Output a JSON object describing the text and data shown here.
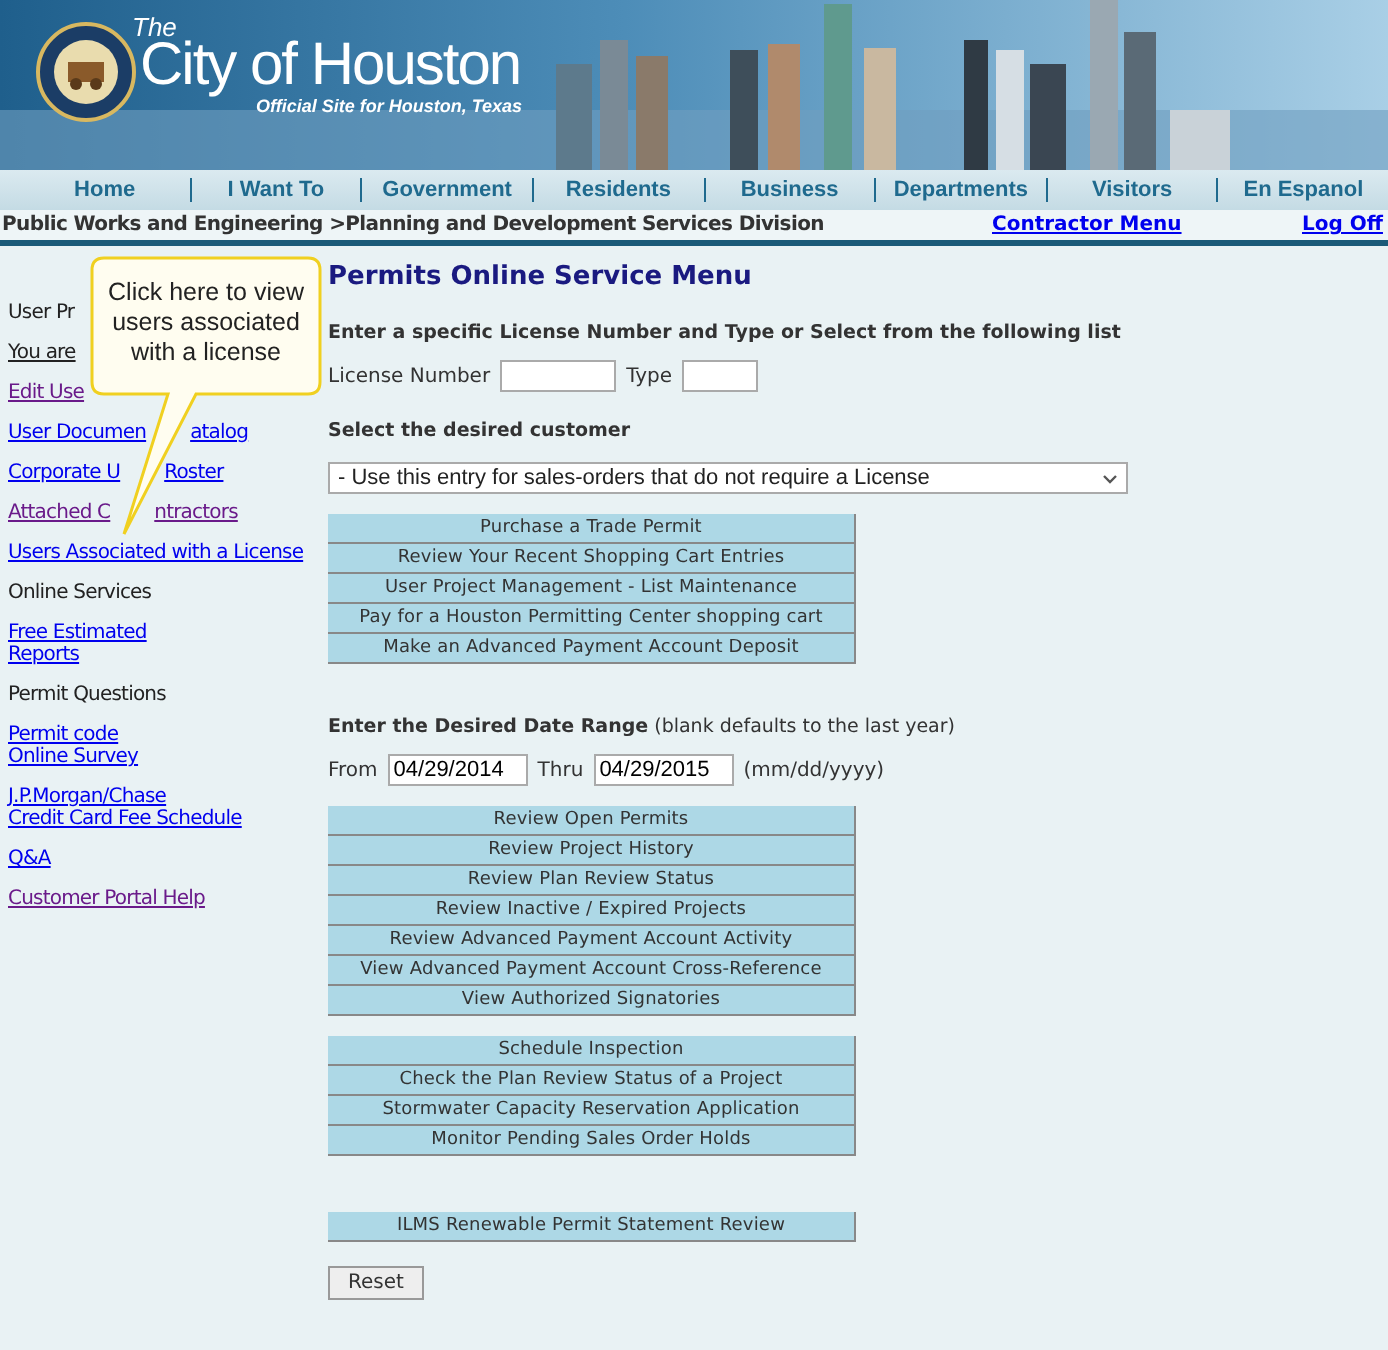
{
  "header": {
    "pretitle": "The",
    "title": "City of Houston",
    "subtitle": "Official Site for Houston, Texas"
  },
  "nav": [
    "Home",
    "I Want To",
    "Government",
    "Residents",
    "Business",
    "Departments",
    "Visitors",
    "En Espanol"
  ],
  "breadcrumb": {
    "path": "Public Works and Engineering >Planning and Development Services Division",
    "links": [
      "Contractor Menu",
      "Log Off"
    ]
  },
  "sidebar": [
    {
      "kind": "heading",
      "lines": [
        {
          "text": "User Pr"
        }
      ]
    },
    {
      "kind": "current",
      "lines": [
        {
          "text": "You are"
        }
      ]
    },
    {
      "kind": "link",
      "visited": true,
      "lines": [
        {
          "text": "Edit Use"
        }
      ]
    },
    {
      "kind": "link",
      "visited": false,
      "lines": [
        {
          "text": "User Documen",
          "after": "atalog"
        }
      ]
    },
    {
      "kind": "link",
      "visited": false,
      "lines": [
        {
          "text": "Corporate U",
          "after": "Roster"
        }
      ]
    },
    {
      "kind": "link",
      "visited": true,
      "lines": [
        {
          "text": "Attached C",
          "after": "ntractors"
        }
      ]
    },
    {
      "kind": "link",
      "visited": false,
      "lines": [
        {
          "text": "Users Associated with a License"
        }
      ]
    },
    {
      "kind": "heading",
      "lines": [
        {
          "text": "Online Services"
        }
      ]
    },
    {
      "kind": "link",
      "visited": false,
      "lines": [
        {
          "text": "Free Estimated"
        },
        {
          "text": "Reports"
        }
      ]
    },
    {
      "kind": "heading",
      "lines": [
        {
          "text": "Permit Questions"
        }
      ]
    },
    {
      "kind": "link",
      "visited": false,
      "lines": [
        {
          "text": "Permit code"
        },
        {
          "text": "Online Survey"
        }
      ]
    },
    {
      "kind": "link",
      "visited": false,
      "lines": [
        {
          "text": "J.P.Morgan/Chase"
        },
        {
          "text": "Credit Card Fee Schedule"
        }
      ]
    },
    {
      "kind": "link",
      "visited": false,
      "lines": [
        {
          "text": "Q&A"
        }
      ]
    },
    {
      "kind": "link",
      "visited": true,
      "lines": [
        {
          "text": "Customer Portal Help"
        }
      ]
    }
  ],
  "callout": [
    "Click here to view",
    "users associated",
    "with a license"
  ],
  "main": {
    "title": "Permits Online Service Menu",
    "license": {
      "instruction": "Enter a specific License Number and Type or Select from the following list",
      "number_label": "License Number",
      "type_label": "Type"
    },
    "customer": {
      "label": "Select the desired customer",
      "value": "- Use this entry for sales-orders that do not require a License"
    },
    "buttons_1": [
      "Purchase a Trade Permit",
      "Review Your Recent Shopping Cart Entries",
      "User Project Management - List Maintenance",
      "Pay for a Houston Permitting Center shopping cart",
      "Make an Advanced Payment Account Deposit"
    ],
    "date_range": {
      "heading": "**Enter the Desired Date Range** (blank defaults to the last year)",
      "from_label": "From",
      "from_value": "04/29/2014",
      "thru_label": "Thru",
      "thru_value": "04/29/2015",
      "hint": "(mm/dd/yyyy)"
    },
    "buttons_2": [
      "Review Open Permits",
      "Review Project History",
      "Review Plan Review Status",
      "Review Inactive / Expired Projects",
      "Review Advanced Payment Account Activity",
      "View Advanced Payment Account Cross-Reference"
    ],
    "buttons_2b": [
      "View Authorized Signatories"
    ],
    "buttons_3": [
      "Schedule Inspection",
      "Check the Plan Review Status of a Project",
      "Stormwater Capacity Reservation Application",
      "Monitor Pending Sales Order Holds"
    ],
    "buttons_4": [
      "ILMS Renewable Permit Statement Review"
    ],
    "reset": "Reset"
  }
}
